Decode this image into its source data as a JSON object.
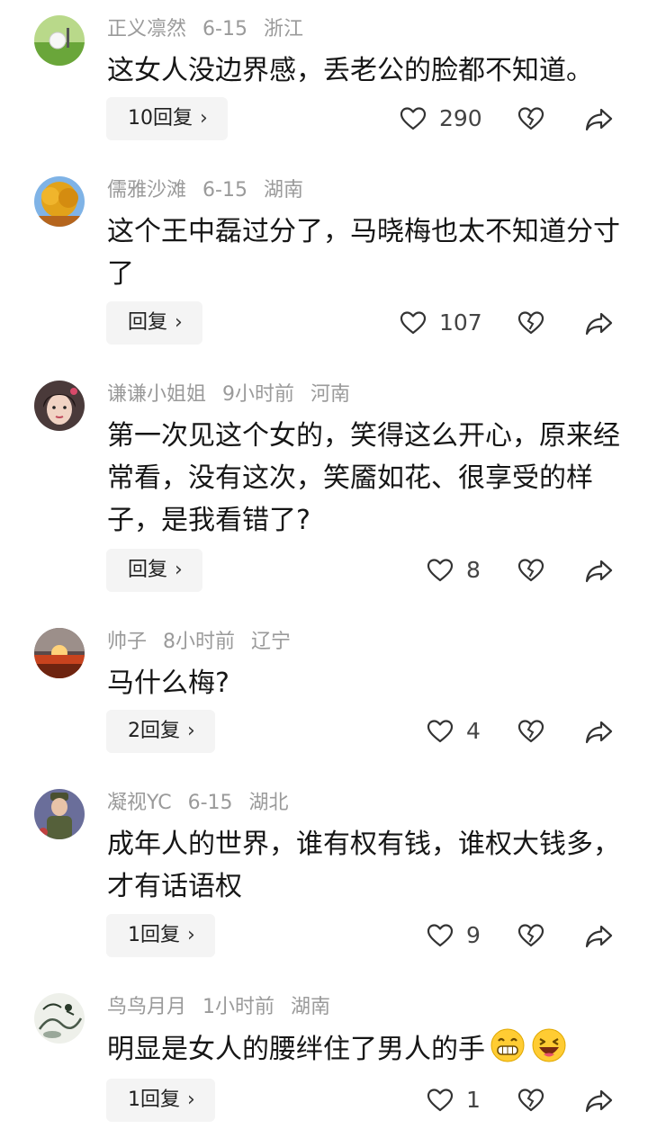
{
  "comments": [
    {
      "user": "正义凛然",
      "date": "6-15",
      "location": "浙江",
      "text": "这女人没边界感，丢老公的脸都不知道。",
      "reply_label": "10回复",
      "likes": "290",
      "avatar": "golf-ball-on-grass"
    },
    {
      "user": "儒雅沙滩",
      "date": "6-15",
      "location": "湖南",
      "text": "这个王中磊过分了，马晓梅也太不知道分寸了",
      "reply_label": "回复",
      "likes": "107",
      "avatar": "autumn-tree"
    },
    {
      "user": "谦谦小姐姐",
      "date": "9小时前",
      "location": "河南",
      "text": "第一次见这个女的，笑得这么开心，原来经常看，没有这次，笑靥如花、很享受的样子，是我看错了?",
      "reply_label": "回复",
      "likes": "8",
      "avatar": "woman-portrait"
    },
    {
      "user": "帅子",
      "date": "8小时前",
      "location": "辽宁",
      "text": "马什么梅?",
      "reply_label": "2回复",
      "likes": "4",
      "avatar": "sunset"
    },
    {
      "user": "凝视YC",
      "date": "6-15",
      "location": "湖北",
      "text": "成年人的世界，谁有权有钱，谁权大钱多，才有话语权",
      "reply_label": "1回复",
      "likes": "9",
      "avatar": "child-in-uniform"
    },
    {
      "user": "鸟鸟月月",
      "date": "1小时前",
      "location": "湖南",
      "text": "明显是女人的腰绊住了男人的手",
      "emojis": [
        "grinning-emoji",
        "laughing-emoji"
      ],
      "reply_label": "1回复",
      "likes": "1",
      "avatar": "ink-painting"
    }
  ],
  "icons": {
    "reply_chevron": "›"
  }
}
